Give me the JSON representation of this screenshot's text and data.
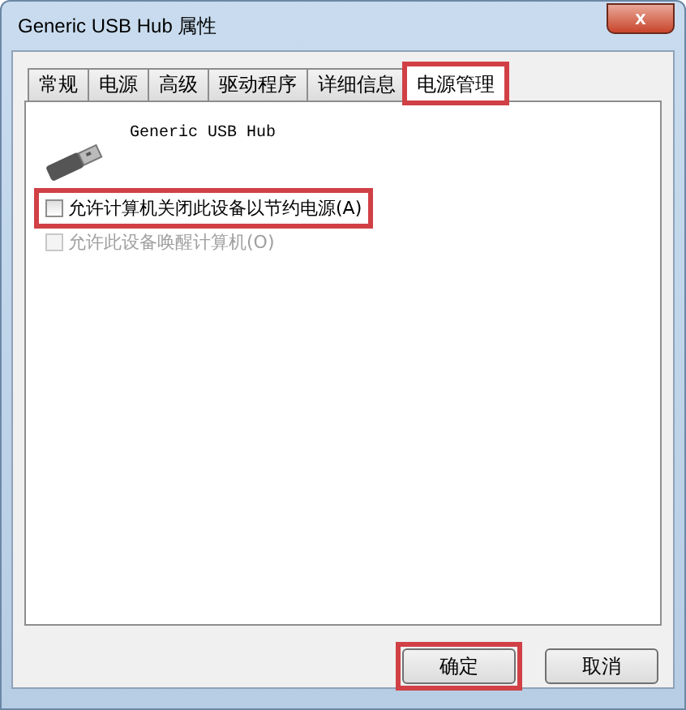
{
  "window": {
    "title": "Generic USB Hub 属性",
    "close": "x"
  },
  "tabs": [
    {
      "label": "常规",
      "selected": false,
      "highlighted": false
    },
    {
      "label": "电源",
      "selected": false,
      "highlighted": false
    },
    {
      "label": "高级",
      "selected": false,
      "highlighted": false
    },
    {
      "label": "驱动程序",
      "selected": false,
      "highlighted": false
    },
    {
      "label": "详细信息",
      "selected": false,
      "highlighted": false
    },
    {
      "label": "电源管理",
      "selected": true,
      "highlighted": true
    }
  ],
  "device": {
    "name": "Generic USB Hub"
  },
  "options": [
    {
      "label": "允许计算机关闭此设备以节约电源(A)",
      "checked": false,
      "disabled": false,
      "highlighted": true
    },
    {
      "label": "允许此设备唤醒计算机(O)",
      "checked": false,
      "disabled": true,
      "highlighted": false
    }
  ],
  "buttons": [
    {
      "label": "确定",
      "highlighted": true
    },
    {
      "label": "取消",
      "highlighted": false
    }
  ]
}
